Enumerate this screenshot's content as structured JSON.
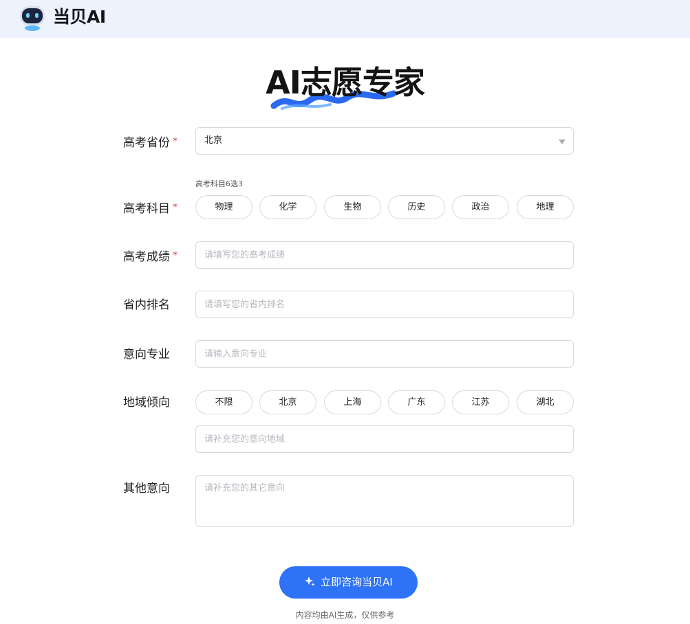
{
  "header": {
    "brand": "当贝AI"
  },
  "hero": {
    "title": "AI志愿专家"
  },
  "form": {
    "required_mark": "*",
    "province": {
      "label": "高考省份",
      "value": "北京"
    },
    "subjects": {
      "label": "高考科目",
      "hint": "高考科目6选3",
      "options": [
        "物理",
        "化学",
        "生物",
        "历史",
        "政治",
        "地理"
      ]
    },
    "score": {
      "label": "高考成绩",
      "placeholder": "请填写您的高考成绩"
    },
    "rank": {
      "label": "省内排名",
      "placeholder": "请填写您的省内排名"
    },
    "major": {
      "label": "意向专业",
      "placeholder": "请输入意向专业"
    },
    "region": {
      "label": "地域倾向",
      "options": [
        "不限",
        "北京",
        "上海",
        "广东",
        "江苏",
        "湖北"
      ],
      "placeholder": "请补充您的意向地域"
    },
    "other": {
      "label": "其他意向",
      "placeholder": "请补充您的其它意向"
    }
  },
  "submit": {
    "label": "立即咨询当贝AI"
  },
  "disclaimer": "内容均由AI生成，仅供参考",
  "colors": {
    "accent": "#2e72f5",
    "header_bg": "#edf2fd",
    "required": "#e53935",
    "border": "#d6d9de"
  },
  "icons": {
    "logo": "robot-mascot-icon",
    "select": "chevron-down-icon",
    "submit": "sparkle-icon"
  }
}
